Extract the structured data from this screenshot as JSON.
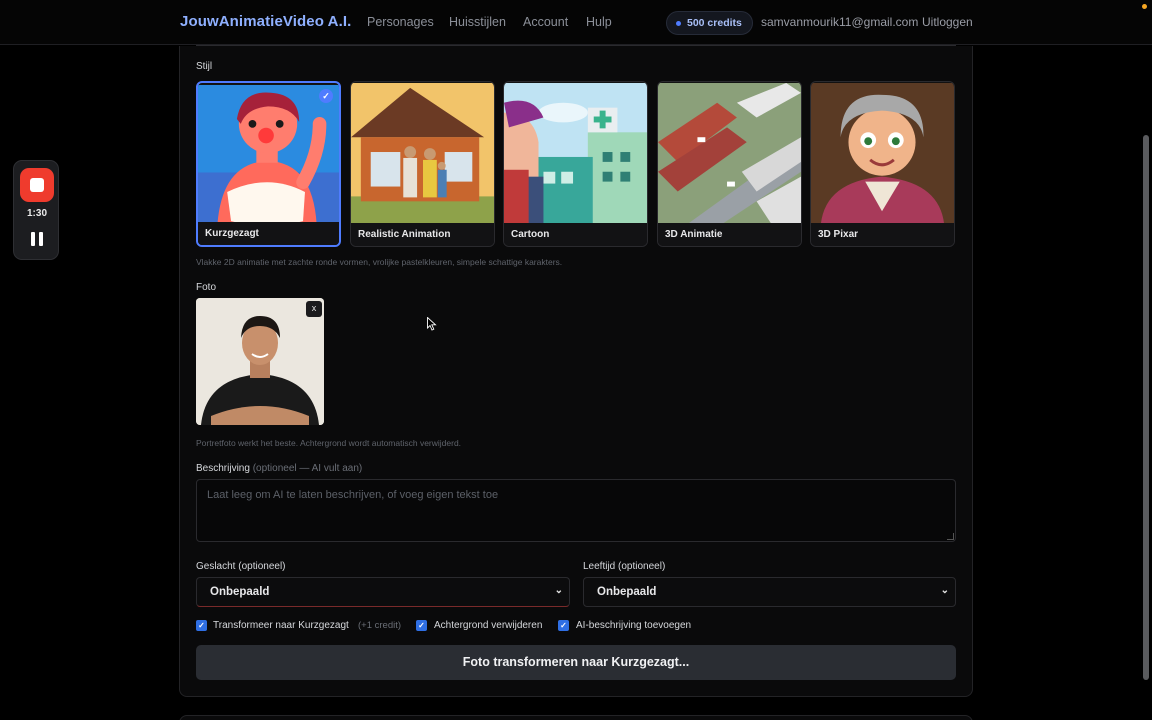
{
  "nav": {
    "brand": "JouwAnimatieVideo A.I.",
    "links": [
      "Personages",
      "Huisstijlen",
      "Account",
      "Hulp"
    ],
    "credits": "500 credits",
    "email": "samvanmourik11@gmail.com",
    "logout": "Uitloggen"
  },
  "form": {
    "style_label": "Stijl",
    "styles": [
      {
        "label": "Kurzgezagt",
        "selected": true
      },
      {
        "label": "Realistic Animation",
        "selected": false
      },
      {
        "label": "Cartoon",
        "selected": false
      },
      {
        "label": "3D Animatie",
        "selected": false
      },
      {
        "label": "3D Pixar",
        "selected": false
      }
    ],
    "style_check": "✓",
    "style_hint": "Vlakke 2D animatie met zachte ronde vormen, vrolijke pastelkleuren, simpele schattige karakters.",
    "photo_label": "Foto",
    "photo_remove": "x",
    "photo_hint": "Portretfoto werkt het beste. Achtergrond wordt automatisch verwijderd.",
    "description_label": "Beschrijving",
    "description_optional": "(optioneel — AI vult aan)",
    "description_placeholder": "Laat leeg om AI te laten beschrijven, of voeg eigen tekst toe",
    "gender_label": "Geslacht (optioneel)",
    "gender_value": "Onbepaald",
    "age_label": "Leeftijd (optioneel)",
    "age_value": "Onbepaald",
    "checkboxes": [
      {
        "label": "Transformeer naar Kurzgezagt",
        "sub": "(+1 credit)",
        "checked": true
      },
      {
        "label": "Achtergrond verwijderen",
        "sub": "",
        "checked": true
      },
      {
        "label": "AI-beschrijving toevoegen",
        "sub": "",
        "checked": true
      }
    ],
    "submit": "Foto transformeren naar Kurzgezagt..."
  },
  "recorder": {
    "time": "1:30"
  },
  "colors": {
    "accent": "#4f7cff",
    "brand": "#8fb0ff",
    "record": "#ef3b2d"
  }
}
